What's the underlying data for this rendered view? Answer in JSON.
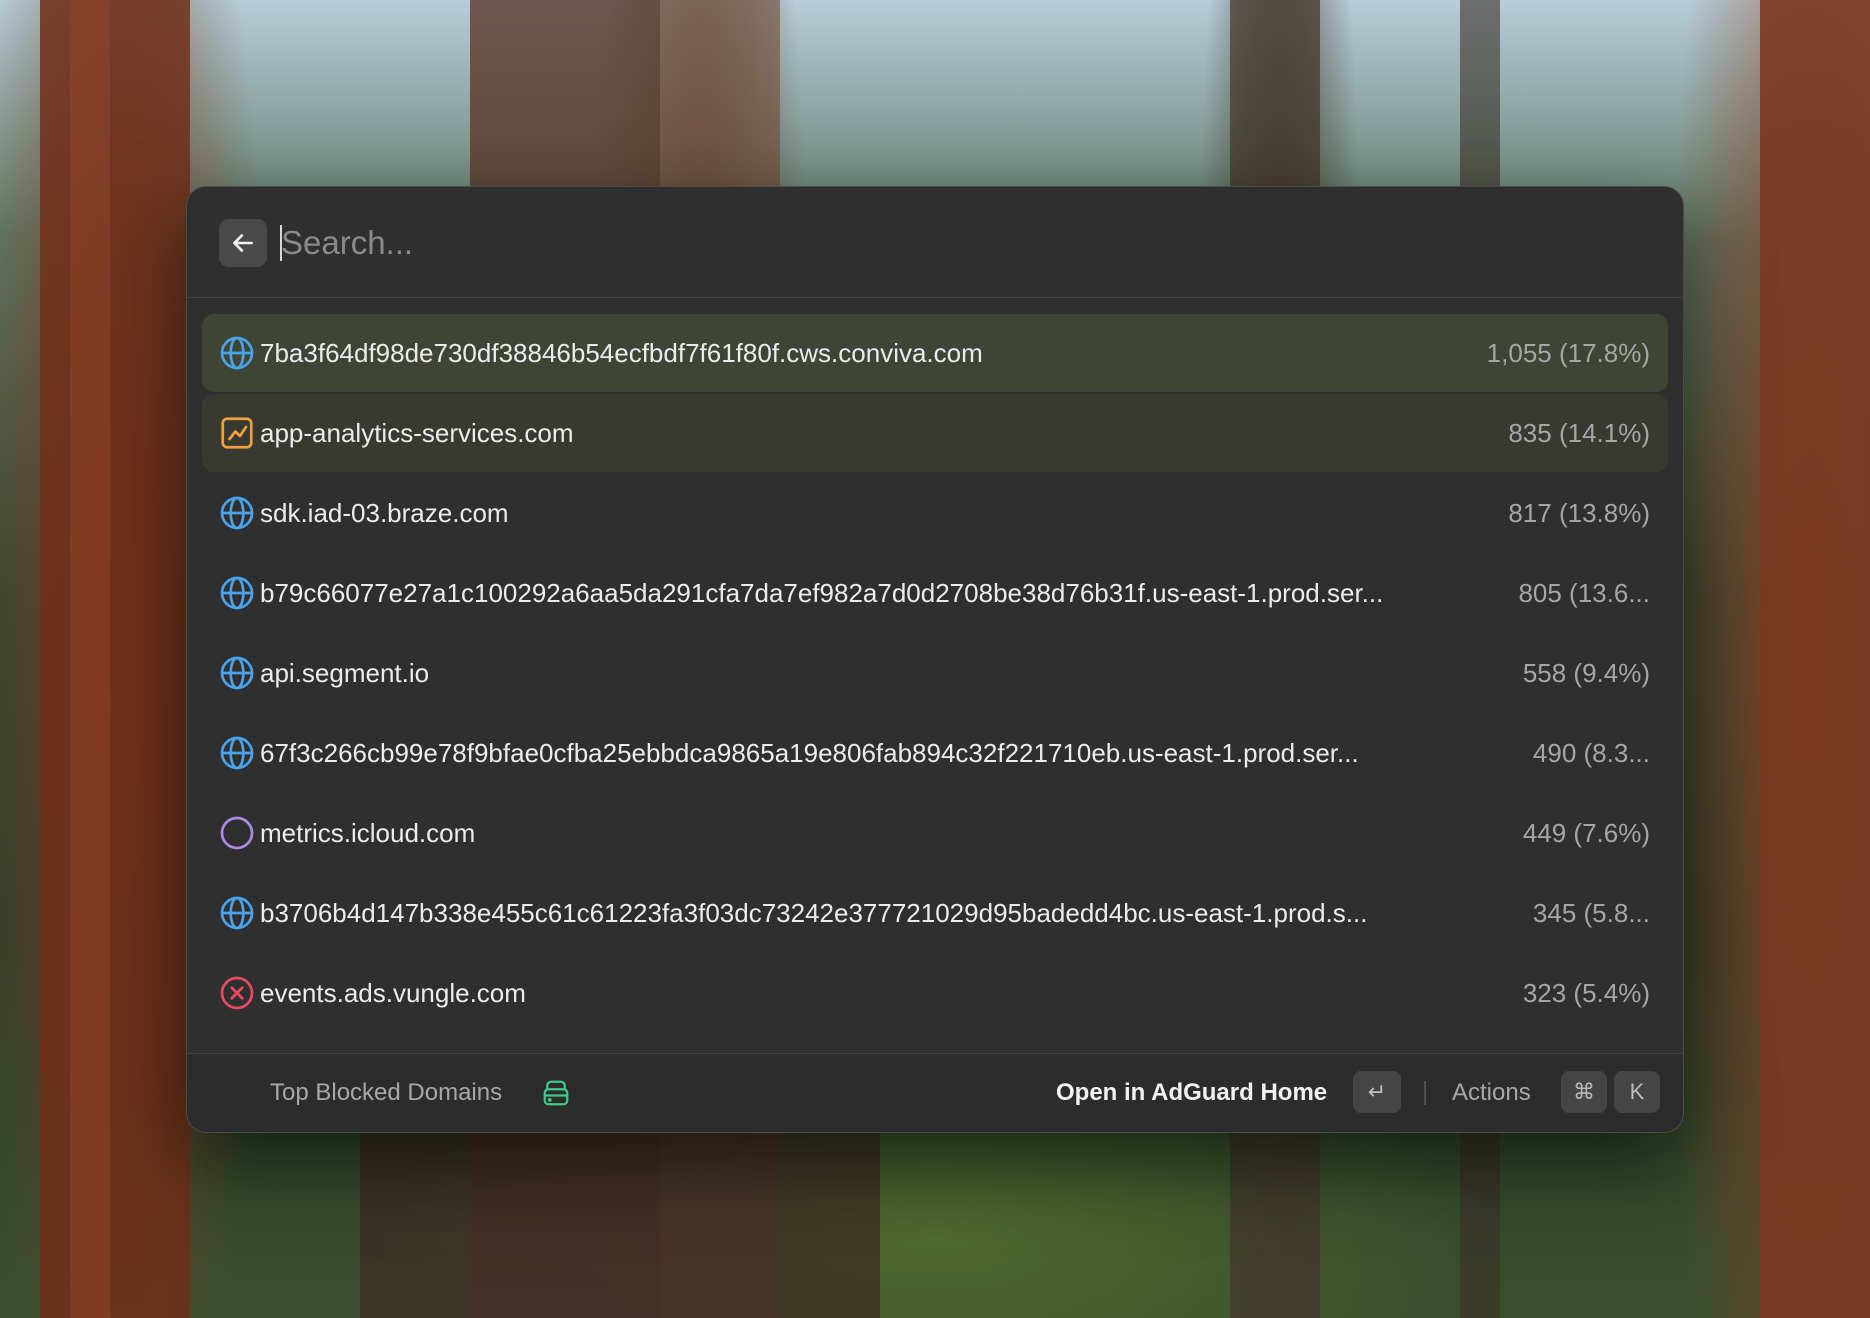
{
  "search": {
    "placeholder": "Search..."
  },
  "results": [
    {
      "domain": "7ba3f64df98de730df38846b54ecfbdf7f61f80f.cws.conviva.com",
      "count": "1,055 (17.8%)",
      "icon": "globe-icon"
    },
    {
      "domain": "app-analytics-services.com",
      "count": "835 (14.1%)",
      "icon": "chart-line-icon"
    },
    {
      "domain": "sdk.iad-03.braze.com",
      "count": "817 (13.8%)",
      "icon": "globe-icon"
    },
    {
      "domain": "b79c66077e27a1c100292a6aa5da291cfa7da7ef982a7d0d2708be38d76b31f.us-east-1.prod.ser...",
      "count": "805 (13.6...",
      "icon": "globe-icon"
    },
    {
      "domain": "api.segment.io",
      "count": "558 (9.4%)",
      "icon": "globe-icon"
    },
    {
      "domain": "67f3c266cb99e78f9bfae0cfba25ebbdca9865a19e806fab894c32f221710eb.us-east-1.prod.ser...",
      "count": "490 (8.3...",
      "icon": "globe-icon"
    },
    {
      "domain": "metrics.icloud.com",
      "count": "449 (7.6%)",
      "icon": "circle-icon"
    },
    {
      "domain": "b3706b4d147b338e455c61c61223fa3f03dc73242e377721029d95badedd4bc.us-east-1.prod.s...",
      "count": "345 (5.8...",
      "icon": "globe-icon"
    },
    {
      "domain": "events.ads.vungle.com",
      "count": "323 (5.4%)",
      "icon": "x-circle-icon"
    }
  ],
  "footer": {
    "title": "Top Blocked Domains",
    "title_icon": "server-icon",
    "primary_action": "Open in AdGuard Home",
    "enter_key": "↵",
    "actions_label": "Actions",
    "cmd_key": "⌘",
    "k_key": "K"
  },
  "colors": {
    "globe": "#4aa3e8",
    "chart": "#f0a040",
    "circle": "#a98ce6",
    "x_circle": "#e84a5f",
    "server": "#3ec98a",
    "selected_row": "#3f4534"
  }
}
